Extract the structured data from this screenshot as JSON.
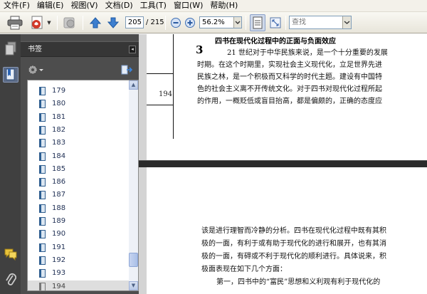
{
  "menu": [
    {
      "label": "文件(F)"
    },
    {
      "label": "编辑(E)"
    },
    {
      "label": "视图(V)"
    },
    {
      "label": "文档(D)"
    },
    {
      "label": "工具(T)"
    },
    {
      "label": "窗口(W)"
    },
    {
      "label": "帮助(H)"
    }
  ],
  "toolbar": {
    "page_current": "205",
    "page_total": "/ 215",
    "zoom": "56.2%",
    "find_placeholder": "查找",
    "icons": [
      "print-icon",
      "create-pdf-icon",
      "dropdown-arrow-icon",
      "secure-icon",
      "previous-page-icon",
      "next-page-icon",
      "zoom-out-icon",
      "zoom-in-icon",
      "fit-width-icon",
      "fit-page-icon"
    ]
  },
  "panel": {
    "title": "书签",
    "collapse_icon": "◂",
    "tools": [
      "options-gear-icon",
      "expand-bookmark-icon"
    ],
    "bookmarks": [
      {
        "label": "179"
      },
      {
        "label": "180"
      },
      {
        "label": "181"
      },
      {
        "label": "182"
      },
      {
        "label": "183"
      },
      {
        "label": "184"
      },
      {
        "label": "185"
      },
      {
        "label": "186"
      },
      {
        "label": "187"
      },
      {
        "label": "188"
      },
      {
        "label": "189"
      },
      {
        "label": "190"
      },
      {
        "label": "191"
      },
      {
        "label": "192"
      },
      {
        "label": "193"
      },
      {
        "label": "194"
      }
    ],
    "selected_index": 15,
    "scroll_position": 0.92,
    "scroll_up": "▲",
    "scroll_down": "▼"
  },
  "leftstrip": {
    "icons": [
      "pages-icon",
      "bookmarks-icon",
      "comments-icon",
      "attachments-icon"
    ]
  },
  "document": {
    "page1": {
      "page_number": "194",
      "section_number": "3",
      "heading": "四书在现代化过程中的正面与负面效应",
      "lines": [
        "21 世纪对于中华民族来说，是一个十分重要的发展",
        "时期。在这个时期里，实现社会主义现代化，立足世界先进",
        "民族之林，是一个积极而又科学的时代主题。建设有中国特",
        "色的社会主义离不开传统文化。对于四书对现代化过程所起",
        "的作用，一概贬低或盲目抬高，都是偏颇的，正确的态度应"
      ]
    },
    "page2": {
      "lines": [
        "该是进行理智而冷静的分析。四书在现代化过程中既有其积",
        "极的一面，有利于或有助于现代化的进行和展开，也有其消",
        "极的一面，有碍或不利于现代化的顺利进行。具体说来，积",
        "极面表现在如下几个方面：",
        "第一，四书中的“富民”思想和义利观有利于现代化的"
      ]
    }
  },
  "colors": {
    "panel_bg": "#4d4d4d",
    "strip_bg": "#404040",
    "doc_bg": "#d4d4d4",
    "divider": "#2b2b2b",
    "bookmark_text": "#1f2f54"
  }
}
